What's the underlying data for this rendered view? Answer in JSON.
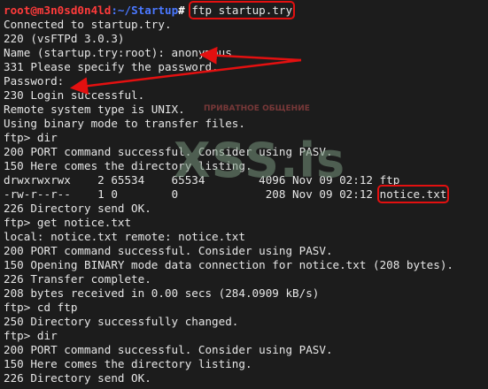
{
  "prompt": {
    "user_host": "root@m3n0sd0n4ld",
    "path": ":~/Startup",
    "hash": "#",
    "command": "ftp startup.try"
  },
  "lines": [
    "Connected to startup.try.",
    "220 (vsFTPd 3.0.3)",
    "Name (startup.try:root): anonymous",
    "331 Please specify the password.",
    "Password:",
    "230 Login successful.",
    "Remote system type is UNIX.",
    "Using binary mode to transfer files.",
    "ftp> dir",
    "200 PORT command successful. Consider using PASV.",
    "150 Here comes the directory listing.",
    "drwxrwxrwx    2 65534    65534        4096 Nov 09 02:12 ftp",
    "-rw-r--r--    1 0        0             208 Nov 09 02:12 ",
    "226 Directory send OK.",
    "ftp> get notice.txt",
    "local: notice.txt remote: notice.txt",
    "200 PORT command successful. Consider using PASV.",
    "150 Opening BINARY mode data connection for notice.txt (208 bytes).",
    "226 Transfer complete.",
    "208 bytes received in 0.00 secs (284.0909 kB/s)",
    "ftp> cd ftp",
    "250 Directory successfully changed.",
    "ftp> dir",
    "200 PORT command successful. Consider using PASV.",
    "150 Here comes the directory listing.",
    "226 Directory send OK."
  ],
  "highlighted_file": "notice.txt",
  "watermark": {
    "main": "XSS.is",
    "small": "ПРИВАТНОЕ ОБЩЕНИЕ"
  },
  "colors": {
    "background": "#1c1c1c",
    "text": "#e6e6e6",
    "prompt_user": "#ff3b3b",
    "prompt_path": "#4a78ff",
    "highlight_box": "#e31010"
  }
}
